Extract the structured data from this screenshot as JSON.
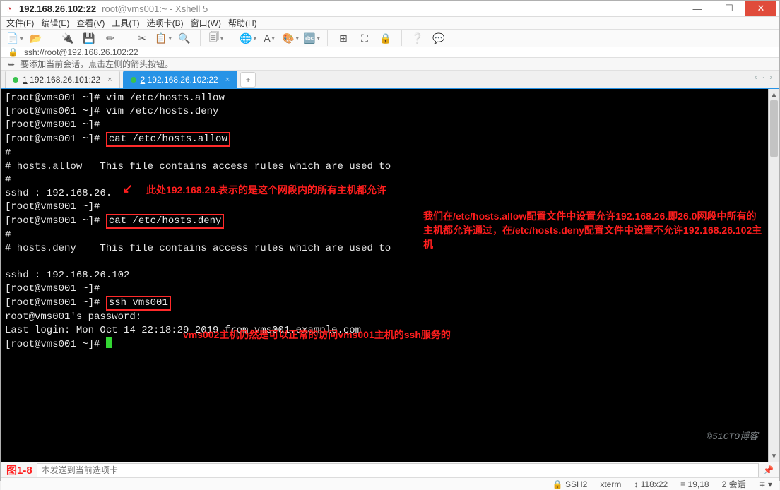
{
  "window": {
    "icon_glyph": "◔",
    "title_strong": "192.168.26.102:22",
    "title_light": "root@vms001:~ - Xshell 5"
  },
  "menu": {
    "file": "文件(F)",
    "edit": "编辑(E)",
    "view": "查看(V)",
    "tools": "工具(T)",
    "tabs": "选项卡(B)",
    "window": "窗口(W)",
    "help": "帮助(H)"
  },
  "toolbar_icons": {
    "new": "📄",
    "open": "📂",
    "connect": "🔌",
    "save": "💾",
    "props": "✏",
    "copy": "✂",
    "paste": "📋",
    "find": "🔍",
    "print": "🗐",
    "globe": "🌐",
    "font": "A",
    "color": "🎨",
    "encoding": "🔤",
    "layout": "⊞",
    "full": "⛶",
    "lock": "🔒",
    "help": "❔",
    "chat": "💬"
  },
  "address": {
    "lock_glyph": "🔒",
    "url": "ssh://root@192.168.26.102:22"
  },
  "hint": {
    "icon": "➥",
    "text": "要添加当前会话，点击左侧的箭头按钮。"
  },
  "tabs": {
    "items": [
      {
        "num": "1",
        "label": "192.168.26.101:22"
      },
      {
        "num": "2",
        "label": "192.168.26.102:22"
      }
    ],
    "add": "+",
    "scroll_hint": "‹ · ›"
  },
  "terminal": {
    "prompt_user": "root@vms001",
    "prompt_path": "~",
    "lines": {
      "l1": "[root@vms001 ~]# vim /etc/hosts.allow",
      "l2": "[root@vms001 ~]# vim /etc/hosts.deny",
      "l3": "[root@vms001 ~]#",
      "l4a": "[root@vms001 ~]# ",
      "l4b": "cat /etc/hosts.allow",
      "l5": "#",
      "l6": "# hosts.allow   This file contains access rules which are used to",
      "l7": "#",
      "l8": "sshd : 192.168.26.",
      "l9": "[root@vms001 ~]#",
      "l10a": "[root@vms001 ~]# ",
      "l10b": "cat /etc/hosts.deny",
      "l11": "#",
      "l12": "# hosts.deny    This file contains access rules which are used to",
      "l13": "",
      "l14": "sshd : 192.168.26.102",
      "l15": "[root@vms001 ~]#",
      "l16a": "[root@vms001 ~]# ",
      "l16b": "ssh vms001",
      "l17": "root@vms001's password:",
      "l18": "Last login: Mon Oct 14 22:18:29 2019 from vms001.example.com",
      "l19": "[root@vms001 ~]# "
    },
    "annotations": {
      "arrow": "↙",
      "note1": "此处192.168.26.表示的是这个网段内的所有主机都允许",
      "note2": "我们在/etc/hosts.allow配置文件中设置允许192.168.26.即26.0网段中所有的主机都允许通过，在/etc/hosts.deny配置文件中设置不允许192.168.26.102主机",
      "note3": "vms002主机仍然是可以正常的访问vms001主机的ssh服务的"
    }
  },
  "input_row": {
    "figure_label": "图1-8",
    "placeholder": "本发送到当前选项卡",
    "pin_glyph": "📌"
  },
  "status": {
    "ssh": "SSH2",
    "ssh_glyph": "🔒",
    "term_type": "xterm",
    "size_glyph": "↕",
    "size": "118x22",
    "pos_glyph": "≡",
    "pos": "19,18",
    "sessions": "2 会话",
    "more_glyph": "∓ ▾"
  },
  "watermark": "©51CTO博客"
}
